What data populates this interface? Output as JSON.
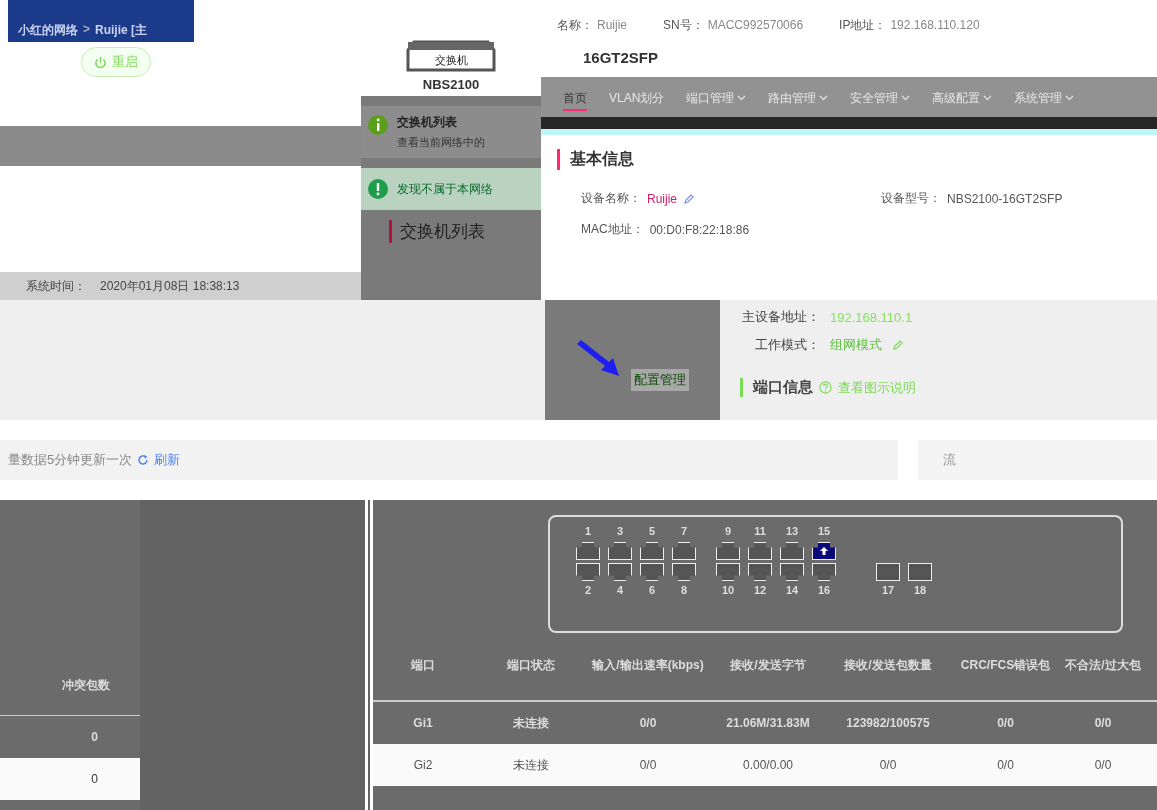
{
  "breadcrumb": {
    "network": "小红的网络",
    "separator": ">",
    "device": "Ruijie [主"
  },
  "restart_button": {
    "label": "重启"
  },
  "system_time": {
    "label": "系统时间：",
    "value": "2020年01月08日 18:38:13"
  },
  "device_image": {
    "label": "交换机",
    "model": "NBS2100"
  },
  "popup": {
    "info_title": "交换机列表",
    "info_text": "查看当前网络中的",
    "alert_text": "发现不属于本网络",
    "heading": "交换机列表"
  },
  "summary": [
    {
      "label": "名称：",
      "value": "Ruijie"
    },
    {
      "label": "SN号：",
      "value": "MACC992570066"
    },
    {
      "label": "IP地址：",
      "value": "192.168.110.120"
    }
  ],
  "model_suffix": "16GT2SFP",
  "tabs": [
    {
      "label": "首页",
      "selected": true,
      "dropdown": false
    },
    {
      "label": "VLAN划分",
      "selected": false,
      "dropdown": false
    },
    {
      "label": "端口管理",
      "selected": false,
      "dropdown": true
    },
    {
      "label": "路由管理",
      "selected": false,
      "dropdown": true
    },
    {
      "label": "安全管理",
      "selected": false,
      "dropdown": true
    },
    {
      "label": "高级配置",
      "selected": false,
      "dropdown": true
    },
    {
      "label": "系统管理",
      "selected": false,
      "dropdown": true
    }
  ],
  "basic_info": {
    "title": "基本信息",
    "fields": [
      {
        "label": "设备名称：",
        "value": "Ruijie",
        "editable": true
      },
      {
        "label": "设备型号：",
        "value": "NBS2100-16GT2SFP",
        "editable": false
      },
      {
        "label": "MAC地址：",
        "value": "00:D0:F8:22:18:86",
        "editable": false
      }
    ]
  },
  "network_fields": [
    {
      "label": "主设备地址：",
      "value": "192.168.110.1",
      "editable": false
    },
    {
      "label": "工作模式：",
      "value": "组网模式",
      "editable": true
    }
  ],
  "config_link": "配置管理",
  "port_info": {
    "title": "端口信息",
    "help_link": "查看图示说明"
  },
  "refresh_note": {
    "text": "量数据5分钟更新一次",
    "link": "刷新"
  },
  "right_edge_text": "流",
  "left_table": {
    "columns": [
      "冲突包数"
    ],
    "rows": [
      {
        "cells": [
          "0"
        ],
        "highlighted": false
      },
      {
        "cells": [
          "0"
        ],
        "highlighted": true
      }
    ]
  },
  "ports": [
    {
      "label": "1",
      "kind": "copper",
      "uplink": false
    },
    {
      "label": "2",
      "kind": "copper",
      "uplink": false
    },
    {
      "label": "3",
      "kind": "copper",
      "uplink": false
    },
    {
      "label": "4",
      "kind": "copper",
      "uplink": false
    },
    {
      "label": "5",
      "kind": "copper",
      "uplink": false
    },
    {
      "label": "6",
      "kind": "copper",
      "uplink": false
    },
    {
      "label": "7",
      "kind": "copper",
      "uplink": false
    },
    {
      "label": "8",
      "kind": "copper",
      "uplink": false
    },
    {
      "label": "9",
      "kind": "copper",
      "uplink": false
    },
    {
      "label": "10",
      "kind": "copper",
      "uplink": false
    },
    {
      "label": "11",
      "kind": "copper",
      "uplink": false
    },
    {
      "label": "12",
      "kind": "copper",
      "uplink": false
    },
    {
      "label": "13",
      "kind": "copper",
      "uplink": false
    },
    {
      "label": "14",
      "kind": "copper",
      "uplink": false
    },
    {
      "label": "15",
      "kind": "copper",
      "uplink": true
    },
    {
      "label": "16",
      "kind": "copper",
      "uplink": false
    },
    {
      "label": "17",
      "kind": "sfp",
      "uplink": false
    },
    {
      "label": "18",
      "kind": "sfp",
      "uplink": false
    }
  ],
  "port_table": {
    "columns": [
      "端口",
      "端口状态",
      "输入/输出速率(kbps)",
      "接收/发送字节",
      "接收/发送包数量",
      "CRC/FCS错误包",
      "不合法/过大包"
    ],
    "rows": [
      {
        "cells": [
          "Gi1",
          "未连接",
          "0/0",
          "21.06M/31.83M",
          "123982/100575",
          "0/0",
          "0/0"
        ],
        "highlighted": false
      },
      {
        "cells": [
          "Gi2",
          "未连接",
          "0/0",
          "0.00/0.00",
          "0/0",
          "0/0",
          "0/0"
        ],
        "highlighted": true
      }
    ]
  }
}
